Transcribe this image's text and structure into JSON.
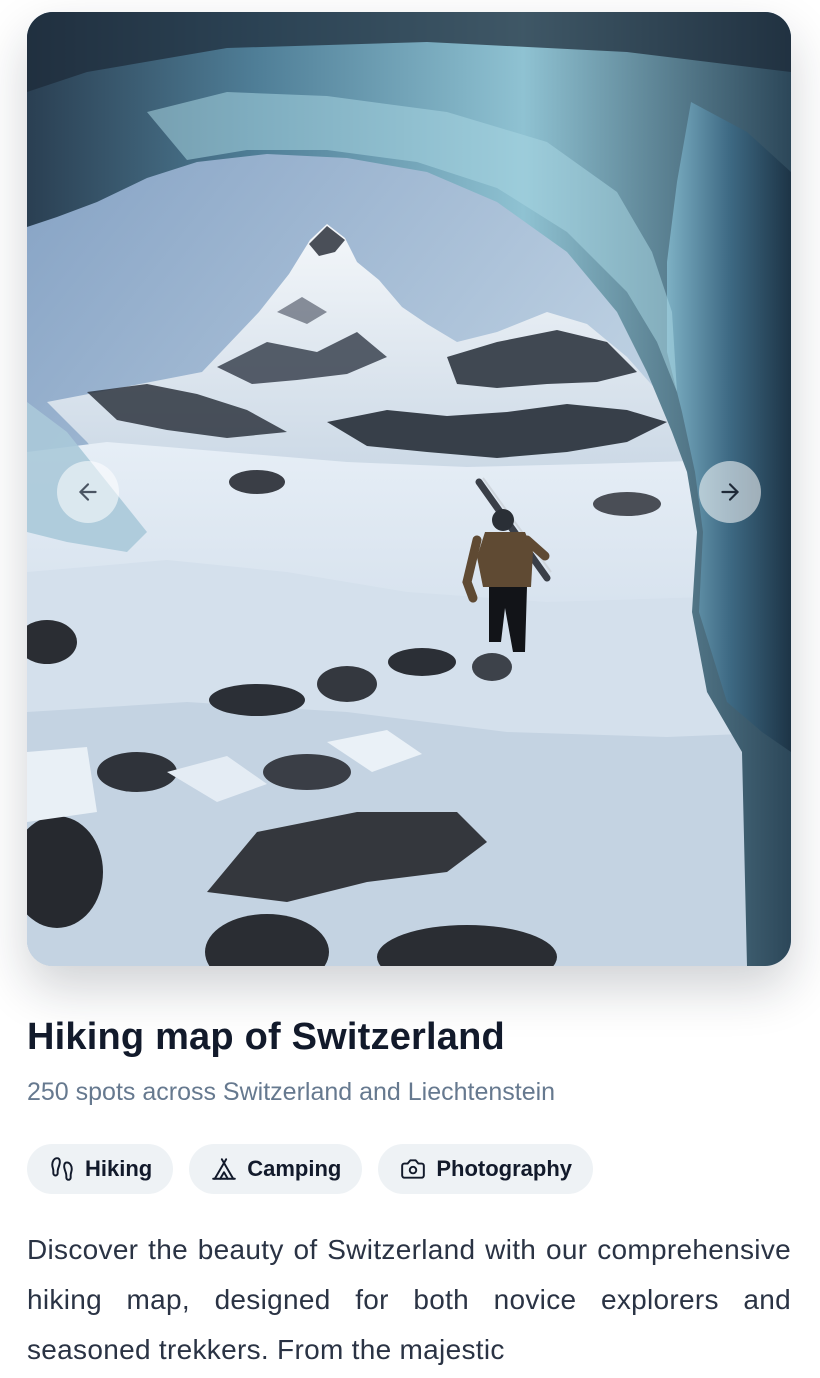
{
  "carousel": {
    "image_alt": "Hiker carrying skis walking out of a blue ice cave toward a snowy mountain peak",
    "prev_icon": "arrow-left-icon",
    "next_icon": "arrow-right-icon"
  },
  "listing": {
    "title": "Hiking map of Switzerland",
    "subtitle": "250 spots across Switzerland and Liechtenstein",
    "tags": [
      {
        "label": "Hiking",
        "icon": "footprints-icon"
      },
      {
        "label": "Camping",
        "icon": "tent-icon"
      },
      {
        "label": "Photography",
        "icon": "camera-icon"
      }
    ],
    "description": "Discover the beauty of Switzerland with our comprehensive hiking map, designed for both novice explorers and seasoned trekkers. From the majestic"
  },
  "colors": {
    "title": "#121a2b",
    "subtitle": "#66798f",
    "tag_background": "#eef2f5",
    "body_text": "#2a3344"
  }
}
